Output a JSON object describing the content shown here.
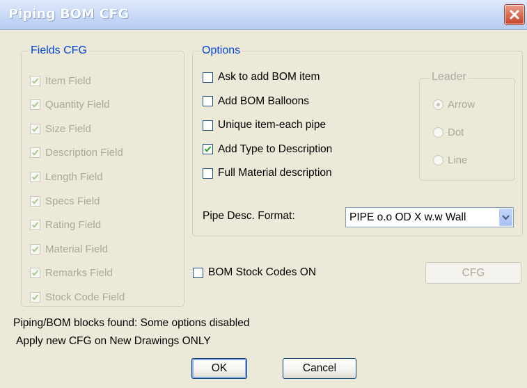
{
  "window": {
    "title": "Piping BOM CFG"
  },
  "fields_cfg": {
    "legend": "Fields CFG",
    "items": [
      {
        "label": "Item Field",
        "checked": true
      },
      {
        "label": "Quantity Field",
        "checked": true
      },
      {
        "label": "Size Field",
        "checked": true
      },
      {
        "label": "Description Field",
        "checked": true
      },
      {
        "label": "Length Field",
        "checked": true
      },
      {
        "label": "Specs Field",
        "checked": true
      },
      {
        "label": "Rating Field",
        "checked": true
      },
      {
        "label": "Material Field",
        "checked": true
      },
      {
        "label": "Remarks Field",
        "checked": true
      },
      {
        "label": "Stock Code Field",
        "checked": true
      }
    ]
  },
  "options": {
    "legend": "Options",
    "items": [
      {
        "label": "Ask to add BOM item",
        "checked": false
      },
      {
        "label": "Add BOM Balloons",
        "checked": false
      },
      {
        "label": "Unique item-each pipe",
        "checked": false
      },
      {
        "label": "Add Type to Description",
        "checked": true
      },
      {
        "label": "Full Material description",
        "checked": false
      }
    ],
    "leader": {
      "legend": "Leader",
      "choices": [
        "Arrow",
        "Dot",
        "Line"
      ],
      "selected": "Arrow"
    },
    "pipe_desc_label": "Pipe Desc. Format:",
    "pipe_desc_value": "PIPE o.o OD X w.w Wall"
  },
  "stock": {
    "label": "BOM Stock Codes ON",
    "checked": false,
    "cfg_button": "CFG"
  },
  "status": {
    "line1": "Piping/BOM blocks found: Some options disabled",
    "line2": "Apply new CFG on New Drawings ONLY"
  },
  "buttons": {
    "ok": "OK",
    "cancel": "Cancel"
  },
  "colors": {
    "dialog_bg": "#ece9d8",
    "legend_blue": "#0046d5",
    "disabled_text": "#aca899",
    "check_green": "#21a121"
  }
}
